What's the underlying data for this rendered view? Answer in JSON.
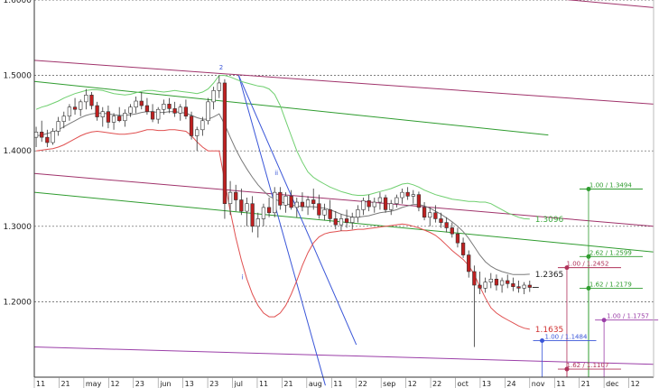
{
  "chart_data": {
    "type": "candlestick",
    "ylim": [
      1.1,
      1.6
    ],
    "y_ticks": [
      "1.2000",
      "1.3000",
      "1.4000",
      "1.5000",
      "1.6000"
    ],
    "x_tick_labels": [
      "11",
      "21",
      "may",
      "12",
      "23",
      "jun",
      "13",
      "23",
      "jul",
      "11",
      "21",
      "aug",
      "11",
      "22",
      "sep",
      "12",
      "22",
      "oct",
      "13",
      "24",
      "nov",
      "11",
      "21",
      "dec",
      "12"
    ],
    "grid": true,
    "ohlc": [
      [
        1.418,
        1.432,
        1.405,
        1.425
      ],
      [
        1.425,
        1.44,
        1.412,
        1.418
      ],
      [
        1.418,
        1.428,
        1.405,
        1.411
      ],
      [
        1.411,
        1.43,
        1.408,
        1.426
      ],
      [
        1.426,
        1.445,
        1.42,
        1.439
      ],
      [
        1.439,
        1.452,
        1.43,
        1.446
      ],
      [
        1.446,
        1.462,
        1.44,
        1.458
      ],
      [
        1.458,
        1.47,
        1.448,
        1.455
      ],
      [
        1.455,
        1.468,
        1.446,
        1.465
      ],
      [
        1.465,
        1.482,
        1.455,
        1.474
      ],
      [
        1.474,
        1.478,
        1.455,
        1.46
      ],
      [
        1.46,
        1.465,
        1.44,
        1.445
      ],
      [
        1.445,
        1.458,
        1.432,
        1.452
      ],
      [
        1.452,
        1.46,
        1.43,
        1.438
      ],
      [
        1.438,
        1.45,
        1.428,
        1.446
      ],
      [
        1.446,
        1.458,
        1.438,
        1.44
      ],
      [
        1.44,
        1.455,
        1.432,
        1.45
      ],
      [
        1.45,
        1.462,
        1.445,
        1.458
      ],
      [
        1.458,
        1.472,
        1.45,
        1.466
      ],
      [
        1.466,
        1.478,
        1.455,
        1.46
      ],
      [
        1.46,
        1.47,
        1.448,
        1.452
      ],
      [
        1.452,
        1.462,
        1.438,
        1.442
      ],
      [
        1.442,
        1.458,
        1.436,
        1.455
      ],
      [
        1.455,
        1.468,
        1.448,
        1.462
      ],
      [
        1.462,
        1.47,
        1.45,
        1.456
      ],
      [
        1.456,
        1.465,
        1.445,
        1.45
      ],
      [
        1.45,
        1.462,
        1.44,
        1.458
      ],
      [
        1.458,
        1.468,
        1.442,
        1.446
      ],
      [
        1.446,
        1.452,
        1.415,
        1.42
      ],
      [
        1.42,
        1.432,
        1.4,
        1.428
      ],
      [
        1.428,
        1.445,
        1.42,
        1.44
      ],
      [
        1.44,
        1.47,
        1.435,
        1.465
      ],
      [
        1.465,
        1.485,
        1.455,
        1.48
      ],
      [
        1.48,
        1.5,
        1.47,
        1.49
      ],
      [
        1.49,
        1.495,
        1.31,
        1.33
      ],
      [
        1.33,
        1.36,
        1.315,
        1.345
      ],
      [
        1.345,
        1.355,
        1.32,
        1.335
      ],
      [
        1.335,
        1.35,
        1.315,
        1.32
      ],
      [
        1.32,
        1.338,
        1.3,
        1.33
      ],
      [
        1.33,
        1.34,
        1.292,
        1.3
      ],
      [
        1.3,
        1.318,
        1.285,
        1.31
      ],
      [
        1.31,
        1.33,
        1.3,
        1.325
      ],
      [
        1.325,
        1.338,
        1.312,
        1.318
      ],
      [
        1.318,
        1.352,
        1.312,
        1.345
      ],
      [
        1.345,
        1.352,
        1.322,
        1.328
      ],
      [
        1.328,
        1.345,
        1.318,
        1.34
      ],
      [
        1.34,
        1.348,
        1.322,
        1.325
      ],
      [
        1.325,
        1.338,
        1.312,
        1.332
      ],
      [
        1.332,
        1.345,
        1.32,
        1.326
      ],
      [
        1.326,
        1.34,
        1.315,
        1.335
      ],
      [
        1.335,
        1.35,
        1.322,
        1.33
      ],
      [
        1.33,
        1.342,
        1.31,
        1.315
      ],
      [
        1.315,
        1.33,
        1.308,
        1.322
      ],
      [
        1.322,
        1.335,
        1.305,
        1.31
      ],
      [
        1.31,
        1.32,
        1.296,
        1.302
      ],
      [
        1.302,
        1.316,
        1.294,
        1.31
      ],
      [
        1.31,
        1.322,
        1.298,
        1.305
      ],
      [
        1.305,
        1.318,
        1.296,
        1.312
      ],
      [
        1.312,
        1.328,
        1.305,
        1.322
      ],
      [
        1.322,
        1.338,
        1.315,
        1.334
      ],
      [
        1.334,
        1.342,
        1.32,
        1.326
      ],
      [
        1.326,
        1.338,
        1.318,
        1.332
      ],
      [
        1.332,
        1.345,
        1.322,
        1.338
      ],
      [
        1.338,
        1.342,
        1.318,
        1.322
      ],
      [
        1.322,
        1.335,
        1.315,
        1.33
      ],
      [
        1.33,
        1.342,
        1.325,
        1.338
      ],
      [
        1.338,
        1.35,
        1.33,
        1.345
      ],
      [
        1.345,
        1.352,
        1.335,
        1.34
      ],
      [
        1.34,
        1.348,
        1.33,
        1.342
      ],
      [
        1.342,
        1.346,
        1.32,
        1.325
      ],
      [
        1.325,
        1.332,
        1.308,
        1.312
      ],
      [
        1.312,
        1.325,
        1.3,
        1.318
      ],
      [
        1.318,
        1.328,
        1.305,
        1.31
      ],
      [
        1.31,
        1.318,
        1.298,
        1.305
      ],
      [
        1.305,
        1.312,
        1.292,
        1.298
      ],
      [
        1.298,
        1.305,
        1.285,
        1.29
      ],
      [
        1.29,
        1.298,
        1.272,
        1.278
      ],
      [
        1.278,
        1.285,
        1.258,
        1.262
      ],
      [
        1.262,
        1.268,
        1.232,
        1.24
      ],
      [
        1.24,
        1.248,
        1.14,
        1.222
      ],
      [
        1.222,
        1.24,
        1.21,
        1.218
      ],
      [
        1.218,
        1.232,
        1.212,
        1.226
      ],
      [
        1.226,
        1.238,
        1.218,
        1.23
      ],
      [
        1.23,
        1.236,
        1.215,
        1.222
      ],
      [
        1.222,
        1.232,
        1.212,
        1.228
      ],
      [
        1.228,
        1.236,
        1.218,
        1.224
      ],
      [
        1.224,
        1.232,
        1.214,
        1.22
      ],
      [
        1.22,
        1.228,
        1.212,
        1.218
      ],
      [
        1.218,
        1.226,
        1.21,
        1.222
      ],
      [
        1.222,
        1.228,
        1.213,
        1.219
      ]
    ],
    "last_close": 1.219,
    "moving_average": [
      1.42,
      1.421,
      1.423,
      1.425,
      1.428,
      1.432,
      1.436,
      1.44,
      1.444,
      1.447,
      1.449,
      1.45,
      1.45,
      1.449,
      1.448,
      1.447,
      1.447,
      1.448,
      1.449,
      1.451,
      1.452,
      1.452,
      1.451,
      1.451,
      1.452,
      1.452,
      1.451,
      1.45,
      1.447,
      1.444,
      1.442,
      1.442,
      1.445,
      1.449,
      1.435,
      1.418,
      1.402,
      1.388,
      1.376,
      1.365,
      1.355,
      1.347,
      1.34,
      1.336,
      1.333,
      1.33,
      1.328,
      1.327,
      1.326,
      1.326,
      1.326,
      1.325,
      1.324,
      1.322,
      1.319,
      1.316,
      1.314,
      1.312,
      1.312,
      1.313,
      1.314,
      1.316,
      1.318,
      1.319,
      1.32,
      1.322,
      1.325,
      1.327,
      1.329,
      1.329,
      1.327,
      1.324,
      1.32,
      1.316,
      1.311,
      1.306,
      1.3,
      1.293,
      1.284,
      1.273,
      1.262,
      1.253,
      1.247,
      1.243,
      1.24,
      1.238,
      1.236,
      1.236,
      1.236,
      1.2365
    ],
    "upper_band": [
      1.455,
      1.458,
      1.46,
      1.463,
      1.466,
      1.47,
      1.473,
      1.476,
      1.478,
      1.48,
      1.481,
      1.481,
      1.48,
      1.478,
      1.476,
      1.475,
      1.474,
      1.475,
      1.477,
      1.479,
      1.48,
      1.48,
      1.479,
      1.478,
      1.479,
      1.48,
      1.479,
      1.478,
      1.477,
      1.476,
      1.478,
      1.482,
      1.49,
      1.5,
      1.5,
      1.498,
      1.495,
      1.492,
      1.49,
      1.488,
      1.486,
      1.485,
      1.482,
      1.475,
      1.46,
      1.44,
      1.42,
      1.4,
      1.385,
      1.372,
      1.365,
      1.36,
      1.356,
      1.352,
      1.349,
      1.346,
      1.344,
      1.342,
      1.341,
      1.341,
      1.342,
      1.344,
      1.346,
      1.348,
      1.35,
      1.353,
      1.356,
      1.357,
      1.355,
      1.352,
      1.348,
      1.345,
      1.342,
      1.34,
      1.338,
      1.336,
      1.335,
      1.334,
      1.333,
      1.333,
      1.332,
      1.332,
      1.33,
      1.326,
      1.322,
      1.318,
      1.315,
      1.312,
      1.31,
      1.3096
    ],
    "lower_band": [
      1.4,
      1.401,
      1.402,
      1.403,
      1.405,
      1.408,
      1.412,
      1.416,
      1.42,
      1.423,
      1.425,
      1.426,
      1.425,
      1.424,
      1.423,
      1.422,
      1.422,
      1.423,
      1.424,
      1.426,
      1.428,
      1.428,
      1.427,
      1.427,
      1.428,
      1.428,
      1.427,
      1.426,
      1.42,
      1.412,
      1.405,
      1.4,
      1.4,
      1.4,
      1.36,
      1.32,
      1.285,
      1.255,
      1.23,
      1.21,
      1.195,
      1.185,
      1.18,
      1.18,
      1.185,
      1.195,
      1.21,
      1.228,
      1.248,
      1.265,
      1.278,
      1.286,
      1.29,
      1.292,
      1.293,
      1.294,
      1.294,
      1.295,
      1.296,
      1.296,
      1.297,
      1.298,
      1.299,
      1.3,
      1.301,
      1.302,
      1.303,
      1.302,
      1.3,
      1.298,
      1.295,
      1.292,
      1.288,
      1.282,
      1.275,
      1.268,
      1.262,
      1.256,
      1.248,
      1.236,
      1.22,
      1.205,
      1.192,
      1.185,
      1.18,
      1.176,
      1.172,
      1.168,
      1.165,
      1.1635
    ],
    "value_labels": {
      "ma": "1.2365",
      "upper": "1.3096",
      "lower": "1.1635"
    },
    "wave_labels": [
      "2",
      "i",
      "ii"
    ],
    "trendlines": [
      {
        "color": "#a0336b",
        "from": [
          0,
          1.52
        ],
        "to": [
          1,
          1.462
        ]
      },
      {
        "color": "#a0336b",
        "from": [
          0.33,
          1.64
        ],
        "to": [
          1,
          1.59
        ]
      },
      {
        "color": "#a0336b",
        "from": [
          0,
          1.37
        ],
        "to": [
          1,
          1.3
        ]
      },
      {
        "color": "#2f9c2f",
        "from": [
          0,
          1.492
        ],
        "to": [
          0.83,
          1.421
        ]
      },
      {
        "color": "#2f9c2f",
        "from": [
          0,
          1.345
        ],
        "to": [
          1,
          1.266
        ]
      },
      {
        "color": "#9b3fa8",
        "from": [
          0,
          1.14
        ],
        "to": [
          1,
          1.117
        ]
      },
      {
        "color": "#3a56d8",
        "from": [
          0.33,
          1.5
        ],
        "to": [
          0.52,
          1.143
        ]
      },
      {
        "color": "#3a56d8",
        "from": [
          0.33,
          1.5
        ],
        "to": [
          0.47,
          1.089
        ]
      }
    ],
    "projections": [
      {
        "label": "1.00 / 1.3494",
        "value": 1.3494,
        "color": "#2f9c2f"
      },
      {
        "label": "2.62 / 1.2599",
        "value": 1.2599,
        "color": "#2f9c2f"
      },
      {
        "label": "1.62 / 1.2179",
        "value": 1.2179,
        "color": "#2f9c2f"
      },
      {
        "label": "1.00 / 1.2452",
        "value": 1.2452,
        "color": "#b0325a"
      },
      {
        "label": "1.00 / 1.1757",
        "value": 1.1757,
        "color": "#9b3fa8"
      },
      {
        "label": "1.00 / 1.1484",
        "value": 1.1484,
        "color": "#3a56d8"
      },
      {
        "label": "1.62 / 1.1107",
        "value": 1.1107,
        "color": "#b0325a"
      }
    ],
    "colors": {
      "bull": "#ffffff",
      "bear": "#c02020",
      "candle_edge": "#333333",
      "ma": "#7a7a7a",
      "upper": "#6fcf6f",
      "lower": "#e05050",
      "grid": "#555555"
    }
  }
}
